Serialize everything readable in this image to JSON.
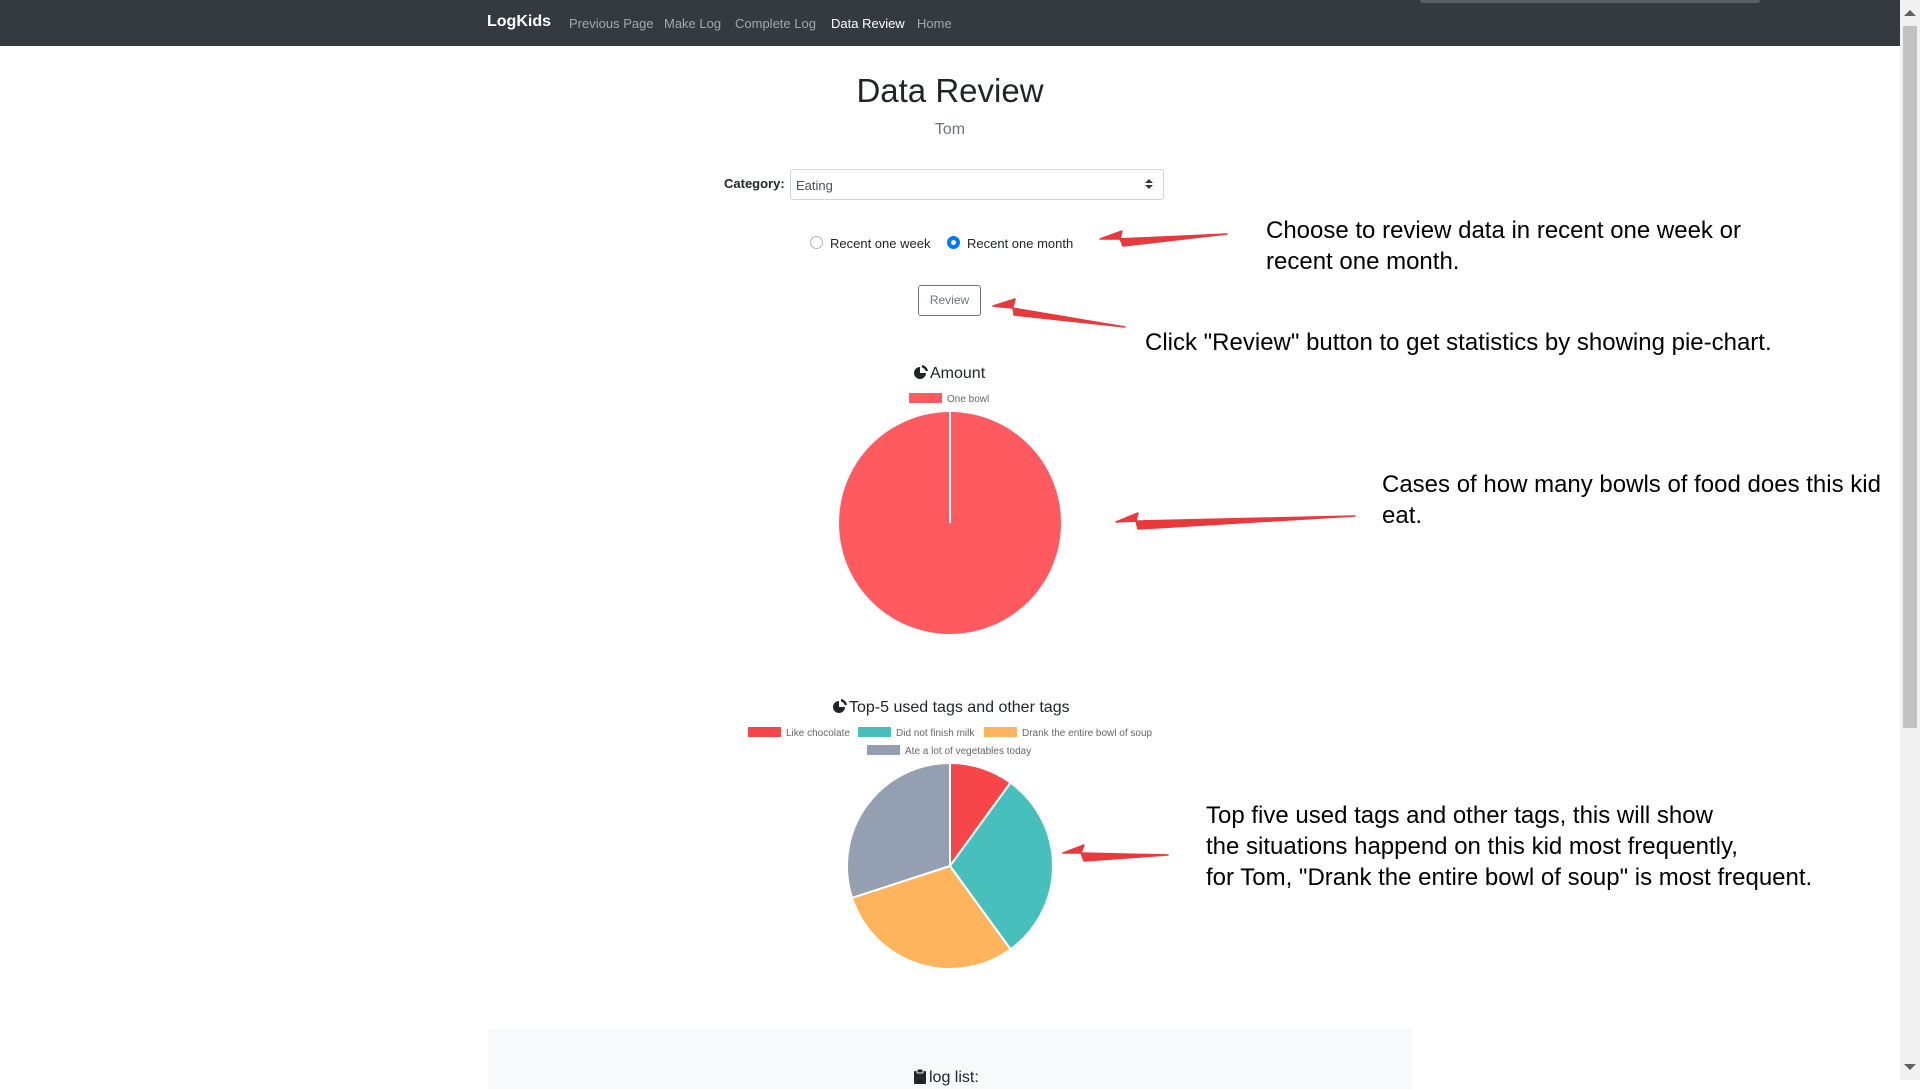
{
  "navbar": {
    "brand": "LogKids",
    "items": [
      {
        "label": "Previous Page",
        "active": false
      },
      {
        "label": "Make Log",
        "active": false
      },
      {
        "label": "Complete Log",
        "active": false
      },
      {
        "label": "Data Review",
        "active": true
      },
      {
        "label": "Home",
        "active": false
      }
    ]
  },
  "header": {
    "title": "Data Review",
    "kid_name": "Tom"
  },
  "form": {
    "category_label": "Category:",
    "category_value": "Eating",
    "period_options": [
      {
        "label": "Recent one week",
        "checked": false
      },
      {
        "label": "Recent one month",
        "checked": true
      }
    ],
    "review_label": "Review"
  },
  "chart_data": [
    {
      "type": "pie",
      "title": "Amount",
      "categories": [
        "One bowl"
      ],
      "values": [
        1
      ],
      "colors": [
        "#ff5a5f"
      ],
      "legend": "top"
    },
    {
      "type": "pie",
      "title": "Top-5 used tags and other tags",
      "categories": [
        "Like chocolate",
        "Did not finish milk",
        "Drank the entire bowl of soup",
        "Ate a lot of vegetables today"
      ],
      "values": [
        1,
        3,
        3,
        3
      ],
      "colors": [
        "#f7464a",
        "#46bfbd",
        "#fdb45c",
        "#949fb1"
      ],
      "legend": "top"
    }
  ],
  "annotations": {
    "note1": [
      "Choose to review data in recent one week or",
      "recent one month."
    ],
    "note2": "Click \"Review\" button to get statistics by showing pie-chart.",
    "note3": [
      "Cases of how many bowls of food does this kid",
      "eat."
    ],
    "note4": [
      "Top five used tags and other tags, this will show",
      "the situations happend on this kid most frequently,",
      "for Tom, \"Drank the entire bowl of soup\" is most frequent."
    ],
    "arrow_color": "#e8393c"
  },
  "log_list": {
    "title": "log list:"
  }
}
